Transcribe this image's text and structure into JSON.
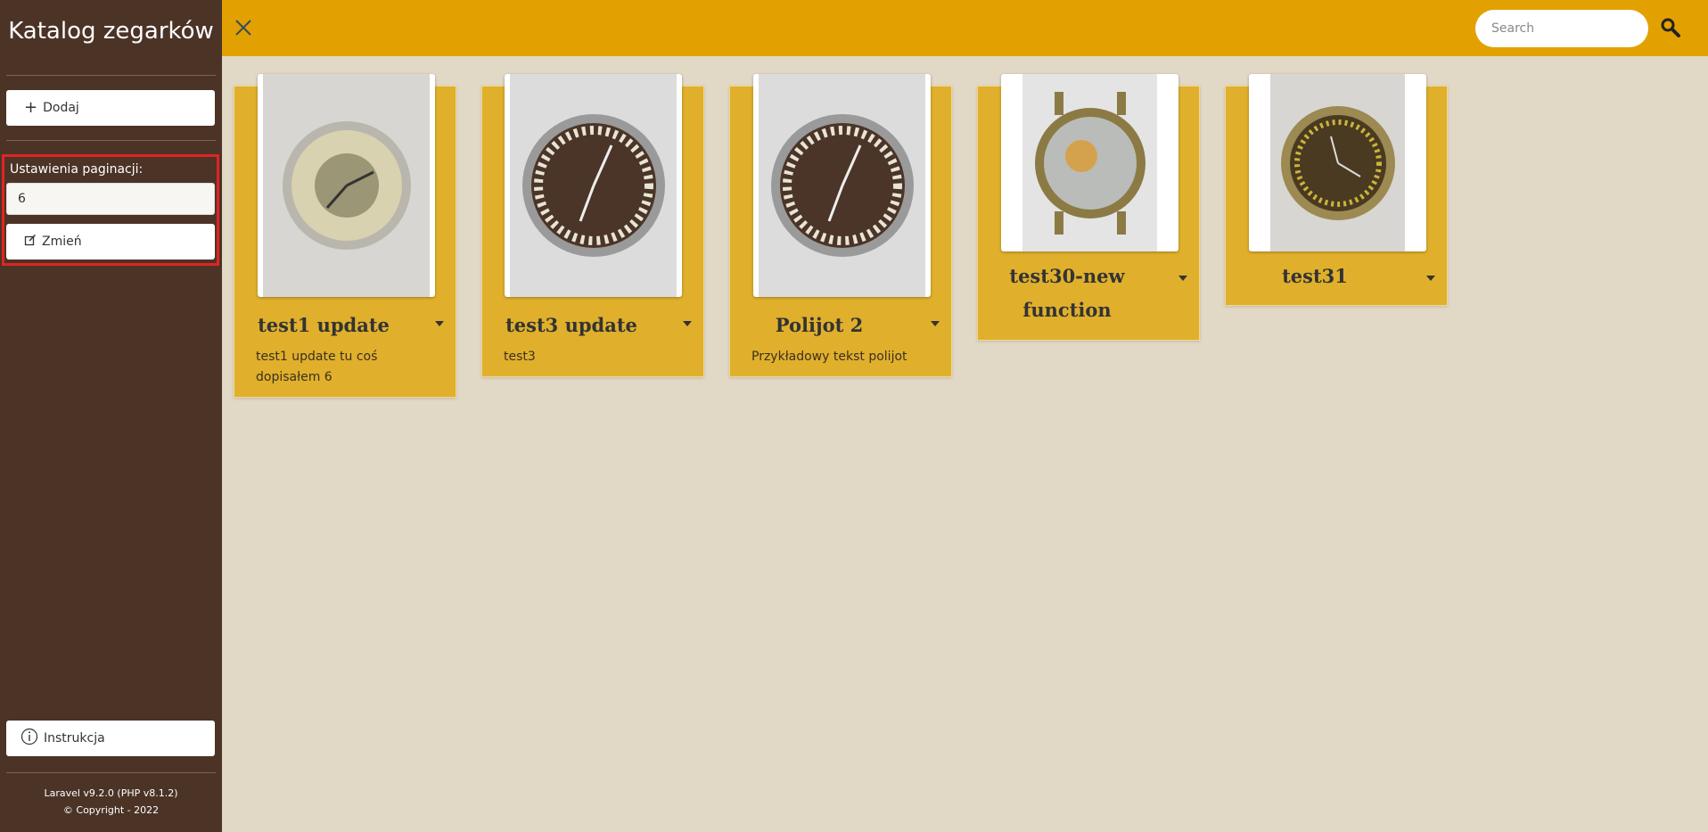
{
  "sidebar": {
    "brand": "Katalog zegarków",
    "add_button": "Dodaj",
    "pagination_label": "Ustawienia paginacji:",
    "pagination_value": "6",
    "change_button": "Zmień",
    "instructions_button": "Instrukcja",
    "footer_line1": "Laravel v9.2.0 (PHP v8.1.2)",
    "footer_line2": "© Copyright - 2022"
  },
  "header": {
    "search_placeholder": "Search",
    "accent_color": "#e2a100"
  },
  "watches": [
    {
      "title": "test1 update",
      "description": "test1 update tu coś dopisałem 6"
    },
    {
      "title": "test3 update",
      "description": "test3"
    },
    {
      "title": "Polijot 2",
      "description": "Przykładowy tekst polijot"
    },
    {
      "title": "test30-new function",
      "description": ""
    },
    {
      "title": "test31",
      "description": ""
    }
  ]
}
